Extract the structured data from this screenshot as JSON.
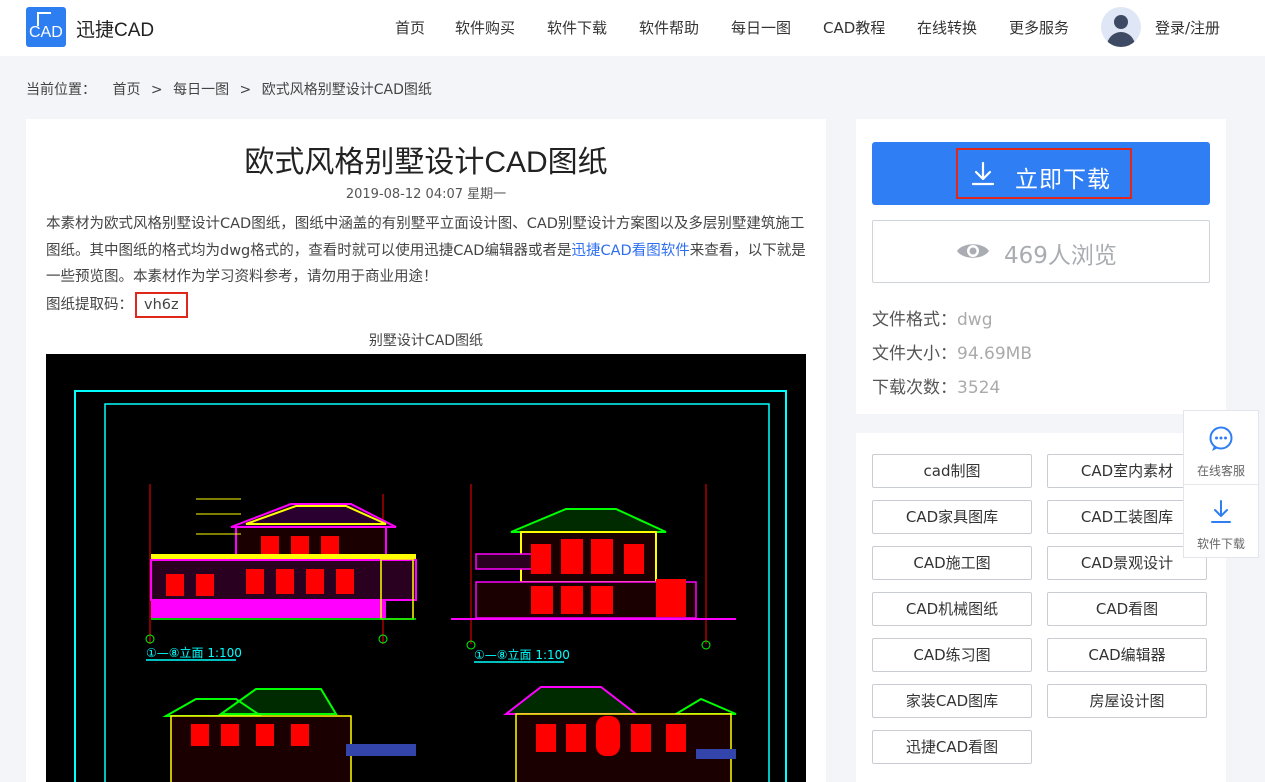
{
  "header": {
    "logo_text": "CAD",
    "brand": "迅捷CAD",
    "nav": [
      "首页",
      "软件购买",
      "软件下载",
      "软件帮助",
      "每日一图",
      "CAD教程",
      "在线转换",
      "更多服务"
    ],
    "login": "登录/注册"
  },
  "breadcrumb": {
    "label": "当前位置：",
    "items": [
      "首页",
      ">",
      "每日一图",
      ">",
      "欧式风格别墅设计CAD图纸"
    ]
  },
  "article": {
    "title": "欧式风格别墅设计CAD图纸",
    "date": "2019-08-12 04:07 星期一",
    "desc_before": "本素材为欧式风格别墅设计CAD图纸，图纸中涵盖的有别墅平立面设计图、CAD别墅设计方案图以及多层别墅建筑施工图纸。其中图纸的格式均为dwg格式的，查看时就可以使用迅捷CAD编辑器或者是",
    "desc_link": "迅捷CAD看图软件",
    "desc_after": "来查看，以下就是一些预览图。本素材作为学习资料参考，请勿用于商业用途！",
    "code_label": "图纸提取码：",
    "code": "vh6z",
    "caption": "别墅设计CAD图纸",
    "drawing_labels": [
      "①—⑧立面 1:100",
      "①—⑧立面 1:100"
    ]
  },
  "sidebar": {
    "download_label": "立即下载",
    "views": "469人浏览",
    "meta": [
      {
        "label": "文件格式：",
        "value": "dwg"
      },
      {
        "label": "文件大小：",
        "value": "94.69MB"
      },
      {
        "label": "下载次数：",
        "value": "3524"
      }
    ],
    "tags": [
      "cad制图",
      "CAD室内素材",
      "CAD家具图库",
      "CAD工装图库",
      "CAD施工图",
      "CAD景观设计",
      "CAD机械图纸",
      "CAD看图",
      "CAD练习图",
      "CAD编辑器",
      "家装CAD图库",
      "房屋设计图",
      "迅捷CAD看图"
    ]
  },
  "float": {
    "service": "在线客服",
    "download": "软件下载"
  },
  "colors": {
    "accent": "#2f7ef3",
    "highlight": "#e0271b",
    "cad_yellow": "#ffff00",
    "cad_magenta": "#ff00ff",
    "cad_red": "#ff0000",
    "cad_green": "#00ff00",
    "cad_cyan": "#00ffff"
  }
}
